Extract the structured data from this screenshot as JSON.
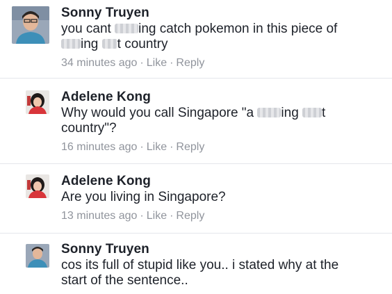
{
  "comments": [
    {
      "author": "Sonny Truyen",
      "text_parts": [
        "you cant ",
        "ing catch pokemon in this piece of ",
        "ing ",
        "t country"
      ],
      "timestamp": "34 minutes ago",
      "like": "Like",
      "reply": "Reply",
      "avatar_icon": "profile-photo"
    },
    {
      "author": "Adelene Kong",
      "text_parts": [
        "Why would you call Singapore \"a ",
        "ing ",
        "t",
        "country\"?"
      ],
      "timestamp": "16 minutes ago",
      "like": "Like",
      "reply": "Reply",
      "avatar_icon": "profile-photo"
    },
    {
      "author": "Adelene Kong",
      "text": "Are you living in Singapore?",
      "timestamp": "13 minutes ago",
      "like": "Like",
      "reply": "Reply",
      "avatar_icon": "profile-photo"
    },
    {
      "author": "Sonny Truyen",
      "text": "cos its full of stupid like you.. i stated why at the start of the sentence..",
      "avatar_icon": "profile-photo"
    }
  ],
  "separator": "·",
  "colors": {
    "name": "#1d2129",
    "meta": "#90949c",
    "divider": "#e4e6eb"
  }
}
